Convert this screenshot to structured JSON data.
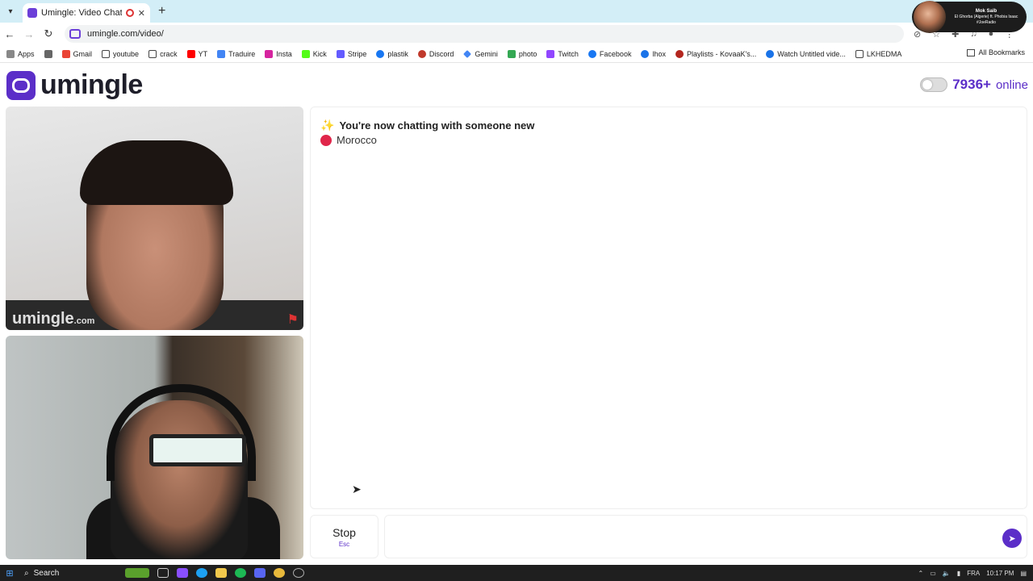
{
  "browser": {
    "tab_title": "Umingle: Video Chat with S",
    "tab_close": "✕",
    "new_tab": "+",
    "url": "umingle.com/video/",
    "back": "←",
    "forward": "→",
    "reload": "↻"
  },
  "profile_card": {
    "name": "Mok Saib",
    "line": "El Ghorba (Algerie) ft. Phobia Isaac",
    "handle": "#JoeRadio"
  },
  "bookmarks": {
    "items": [
      {
        "label": "Apps",
        "color": "#888888"
      },
      {
        "label": "",
        "color": "#666666"
      },
      {
        "label": "Gmail",
        "color": "#ea4335"
      },
      {
        "label": "youtube",
        "color": "#444444"
      },
      {
        "label": "crack",
        "color": "#444444"
      },
      {
        "label": "YT",
        "color": "#ff0000"
      },
      {
        "label": "Traduire",
        "color": "#4285f4"
      },
      {
        "label": "Insta",
        "color": "#d6249f"
      },
      {
        "label": "Kick",
        "color": "#53fc18"
      },
      {
        "label": "Stripe",
        "color": "#635bff"
      },
      {
        "label": "plastik",
        "color": "#1877f2"
      },
      {
        "label": "Discord",
        "color": "#c0392b"
      },
      {
        "label": "Gemini",
        "color": "#4285f4"
      },
      {
        "label": "photo",
        "color": "#34a853"
      },
      {
        "label": "Twitch",
        "color": "#9146ff"
      },
      {
        "label": "Facebook",
        "color": "#1877f2"
      },
      {
        "label": "lhox",
        "color": "#1a73e8"
      },
      {
        "label": "Playlists - KovaaK's...",
        "color": "#b3261e"
      },
      {
        "label": "Watch Untitled vide...",
        "color": "#1a73e8"
      },
      {
        "label": "LKHEDMA",
        "color": "#666666"
      }
    ],
    "all": "All Bookmarks"
  },
  "header": {
    "logo_text": "umingle",
    "online_count": "7936+",
    "online_label": "online"
  },
  "video": {
    "watermark": "umingle",
    "watermark_suffix": ".com"
  },
  "chat": {
    "system_message": "You're now chatting with someone new",
    "country": "Morocco"
  },
  "controls": {
    "stop_label": "Stop",
    "stop_key": "Esc",
    "message_placeholder": ""
  },
  "taskbar": {
    "search": "Search",
    "lang": "FRA",
    "time": "10:17 PM"
  },
  "colors": {
    "brand": "#5b2ec8",
    "country_dot": "#e0264a"
  }
}
